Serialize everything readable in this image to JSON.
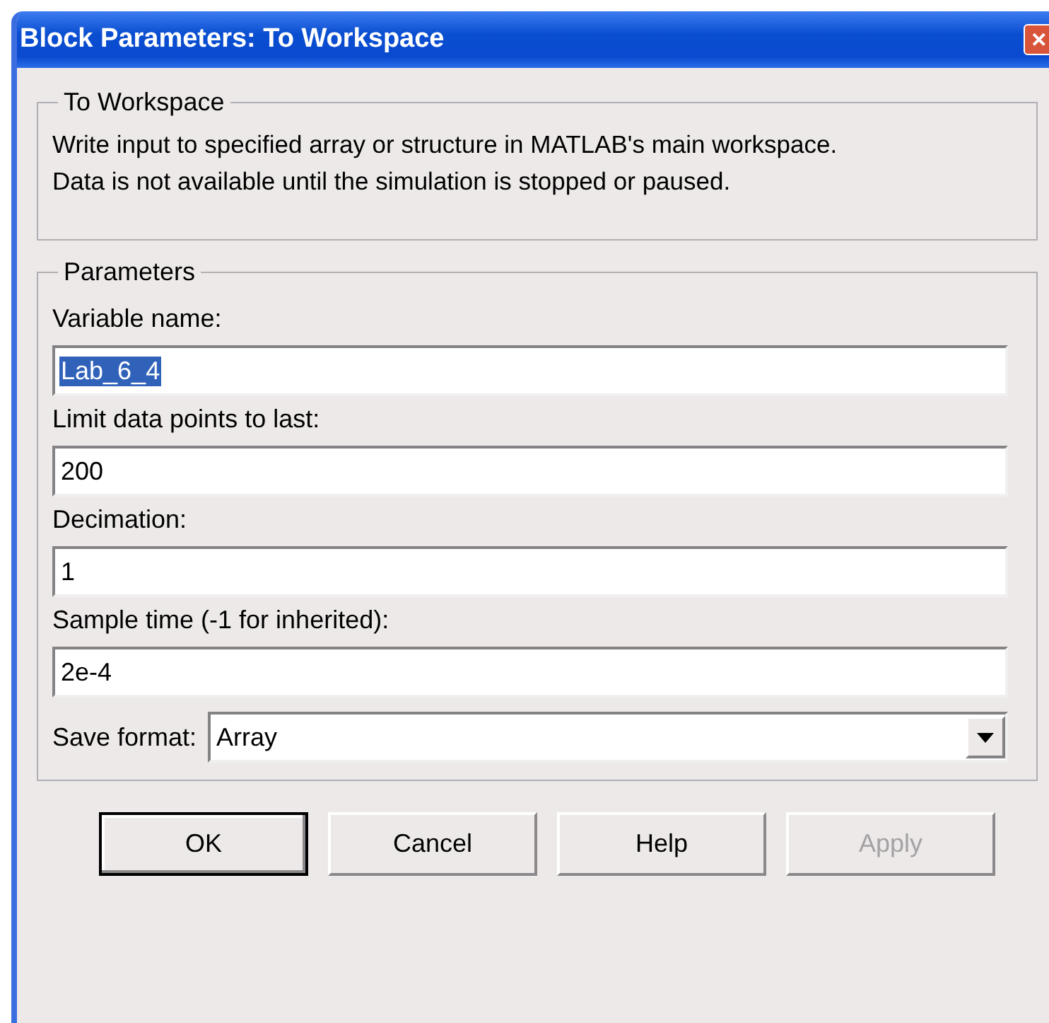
{
  "window": {
    "title": "Block Parameters: To Workspace",
    "close": "✕"
  },
  "description_group": {
    "legend": "To Workspace",
    "text": "Write input to specified array or structure in MATLAB's main workspace.\nData is not available until the simulation is stopped or paused."
  },
  "parameters_group": {
    "legend": "Parameters",
    "fields": [
      {
        "kind": "text",
        "label": "Variable name:",
        "value": "Lab_6_4",
        "selected": true
      },
      {
        "kind": "text",
        "label": "Limit data points to last:",
        "value": "200",
        "selected": false
      },
      {
        "kind": "text",
        "label": "Decimation:",
        "value": "1",
        "selected": false
      },
      {
        "kind": "text",
        "label": "Sample time (-1 for inherited):",
        "value": "2e-4",
        "selected": false
      },
      {
        "kind": "select",
        "label": "Save format:",
        "value": "Array"
      }
    ]
  },
  "buttons": [
    {
      "label": "OK",
      "default": true,
      "disabled": false
    },
    {
      "label": "Cancel",
      "default": false,
      "disabled": false
    },
    {
      "label": "Help",
      "default": false,
      "disabled": false
    },
    {
      "label": "Apply",
      "default": false,
      "disabled": true
    }
  ]
}
